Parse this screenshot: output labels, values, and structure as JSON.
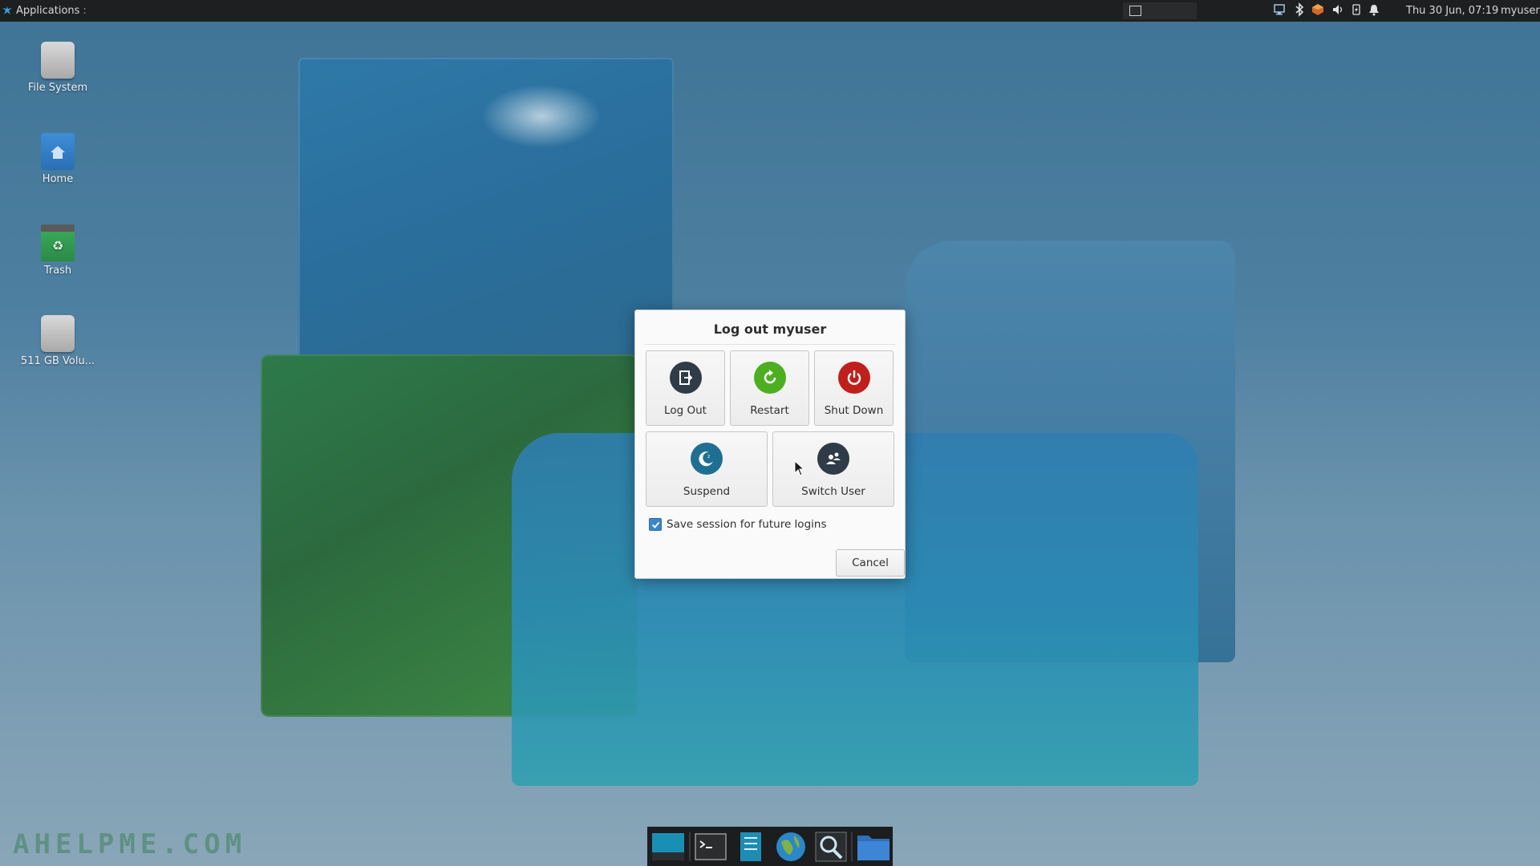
{
  "top_panel": {
    "applications_label": "Applications",
    "applications_suffix": ":",
    "clock": "Thu 30 Jun, 07:19",
    "user": "myuser",
    "tray_icons": [
      "network-icon",
      "bluetooth-icon",
      "package-update-icon",
      "volume-icon",
      "power-icon",
      "notification-bell-icon"
    ]
  },
  "desktop": {
    "icons": [
      {
        "label": "File System",
        "icon": "drive-icon"
      },
      {
        "label": "Home",
        "icon": "home-folder-icon"
      },
      {
        "label": "Trash",
        "icon": "trash-icon"
      },
      {
        "label": "511 GB Volu...",
        "icon": "drive-icon"
      }
    ],
    "watermark": "AHELPME.COM"
  },
  "dialog": {
    "title": "Log out myuser",
    "buttons": [
      {
        "label": "Log Out",
        "icon": "logout-icon",
        "color": "#2f3b46"
      },
      {
        "label": "Restart",
        "icon": "restart-icon",
        "color": "#4caf22"
      },
      {
        "label": "Shut Down",
        "icon": "power-icon",
        "color": "#c0201c"
      },
      {
        "label": "Suspend",
        "icon": "suspend-moon-icon",
        "color": "#1f6f93"
      },
      {
        "label": "Switch User",
        "icon": "switch-user-icon",
        "color": "#2f3b46"
      }
    ],
    "save_session_label": "Save session for future logins",
    "save_session_checked": true,
    "cancel_label": "Cancel"
  },
  "dock": {
    "items": [
      "show-desktop-icon",
      "terminal-icon",
      "file-manager-icon",
      "web-browser-icon",
      "app-finder-icon",
      "folder-icon"
    ]
  }
}
